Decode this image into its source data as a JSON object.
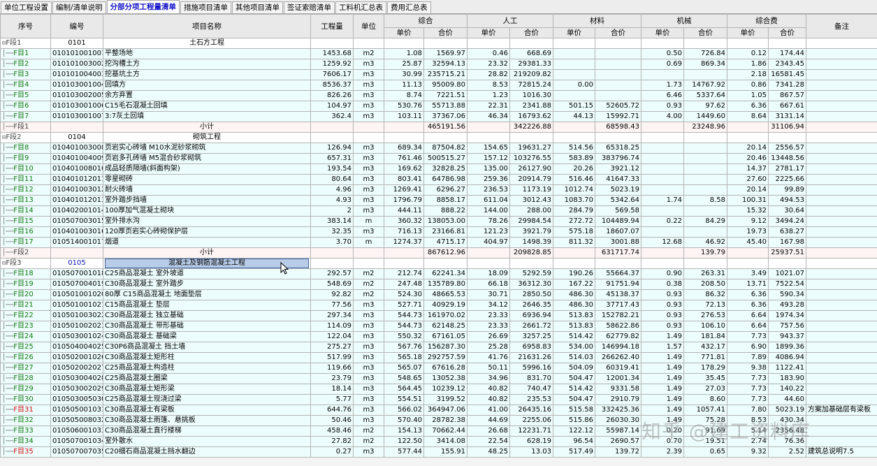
{
  "tabs": [
    "单位工程设置",
    "编制/清单说明",
    "分部分项工程量清单",
    "措施项目清单",
    "其他项目清单",
    "签证索赔清单",
    "工料机汇总表",
    "费用汇总表"
  ],
  "header": {
    "seq": "序号",
    "code": "编号",
    "name": "项目名称",
    "qty": "工程量",
    "unit": "单位",
    "groups": [
      "综合",
      "人工",
      "材料",
      "机械",
      "综合费"
    ],
    "unit_price": "单价",
    "total": "合价",
    "remark": "备注"
  },
  "rows": [
    {
      "type": "seg",
      "seq": "F段1",
      "code": "0101",
      "name": "土石方工程"
    },
    {
      "type": "item",
      "seq": "F目1",
      "code": "010101001001",
      "name": "平整场地",
      "qty": "1453.68",
      "unit": "m2",
      "c": [
        "1.08",
        "1569.97",
        "0.46",
        "668.69",
        "",
        "",
        "0.50",
        "726.84",
        "0.12",
        "174.44"
      ],
      "remark": ""
    },
    {
      "type": "item",
      "seq": "F目2",
      "code": "010101003002",
      "name": "挖沟槽土方",
      "qty": "1259.92",
      "unit": "m3",
      "c": [
        "25.87",
        "32594.13",
        "23.32",
        "29381.33",
        "",
        "",
        "0.69",
        "869.34",
        "1.86",
        "2343.45"
      ],
      "remark": ""
    },
    {
      "type": "item",
      "seq": "F目3",
      "code": "010101004003",
      "name": "挖基坑土方",
      "qty": "7606.17",
      "unit": "m3",
      "c": [
        "30.99",
        "235715.21",
        "28.82",
        "219209.82",
        "",
        "",
        "",
        "",
        "2.18",
        "16581.45"
      ],
      "remark": ""
    },
    {
      "type": "item",
      "seq": "F目4",
      "code": "010103001004",
      "name": "回填方",
      "qty": "8536.37",
      "unit": "m3",
      "c": [
        "11.13",
        "95009.80",
        "8.53",
        "72815.24",
        "0.00",
        "",
        "1.73",
        "14767.92",
        "0.86",
        "7341.28"
      ],
      "remark": ""
    },
    {
      "type": "item",
      "seq": "F目5",
      "code": "010103002005",
      "name": "余方弃置",
      "qty": "826.26",
      "unit": "m3",
      "c": [
        "8.74",
        "7221.51",
        "1.23",
        "1016.30",
        "",
        "",
        "6.46",
        "5337.64",
        "1.05",
        "867.57"
      ],
      "remark": ""
    },
    {
      "type": "item",
      "seq": "F目6",
      "code": "010103001006",
      "name": "C15毛石混凝土回填",
      "qty": "104.97",
      "unit": "m3",
      "c": [
        "530.76",
        "55713.88",
        "22.31",
        "2341.88",
        "501.15",
        "52605.72",
        "0.93",
        "97.62",
        "6.36",
        "667.61"
      ],
      "remark": ""
    },
    {
      "type": "item",
      "seq": "F目7",
      "code": "010103001007",
      "name": "3:7灰土回填",
      "qty": "362.4",
      "unit": "m3",
      "c": [
        "103.11",
        "37367.06",
        "46.34",
        "16793.62",
        "44.13",
        "15992.71",
        "4.00",
        "1449.60",
        "8.64",
        "3131.14"
      ],
      "remark": ""
    },
    {
      "type": "sub",
      "seq": "F段1",
      "name": "小计",
      "c": [
        "",
        "465191.56",
        "",
        "342226.88",
        "",
        "68598.43",
        "",
        "23248.96",
        "",
        "31106.94"
      ]
    },
    {
      "type": "seg",
      "seq": "F段2",
      "code": "0104",
      "name": "砌筑工程"
    },
    {
      "type": "item",
      "seq": "F目8",
      "code": "010401003008",
      "name": "页岩实心砖墙  M10水泥砂浆砌筑",
      "qty": "126.94",
      "unit": "m3",
      "c": [
        "689.34",
        "87504.82",
        "154.65",
        "19631.27",
        "514.56",
        "65318.25",
        "",
        "",
        "20.14",
        "2556.57"
      ],
      "remark": ""
    },
    {
      "type": "item",
      "seq": "F目9",
      "code": "010401004009",
      "name": "页岩多孔砖墙  M5混合砂浆砌筑",
      "qty": "657.31",
      "unit": "m3",
      "c": [
        "761.46",
        "500515.27",
        "157.12",
        "103276.55",
        "583.89",
        "383796.74",
        "",
        "",
        "20.46",
        "13448.56"
      ],
      "remark": ""
    },
    {
      "type": "item",
      "seq": "F目10",
      "code": "010401008010",
      "name": "成品轻质隔墙(斜面构架)",
      "qty": "193.54",
      "unit": "m3",
      "c": [
        "169.62",
        "32828.25",
        "135.00",
        "26127.90",
        "20.26",
        "3921.12",
        "",
        "",
        "14.37",
        "2781.17"
      ],
      "remark": ""
    },
    {
      "type": "item",
      "seq": "F目11",
      "code": "010401012011",
      "name": "零星砌砖",
      "qty": "80.64",
      "unit": "m3",
      "c": [
        "803.41",
        "64786.98",
        "259.36",
        "20914.79",
        "516.46",
        "41647.33",
        "",
        "",
        "27.60",
        "2225.66"
      ],
      "remark": ""
    },
    {
      "type": "item",
      "seq": "F目12",
      "code": "010401003012",
      "name": "耐火砖墙",
      "qty": "4.96",
      "unit": "m3",
      "c": [
        "1269.41",
        "6296.27",
        "236.53",
        "1173.19",
        "1012.74",
        "5023.19",
        "",
        "",
        "20.14",
        "99.89"
      ],
      "remark": ""
    },
    {
      "type": "item",
      "seq": "F目13",
      "code": "010401012013",
      "name": "室外踏步挡墙",
      "qty": "4.93",
      "unit": "m3",
      "c": [
        "1796.79",
        "8858.17",
        "611.04",
        "3012.43",
        "1083.70",
        "5342.64",
        "1.74",
        "8.58",
        "100.31",
        "494.53"
      ],
      "remark": ""
    },
    {
      "type": "item",
      "seq": "F目14",
      "code": "010402001014",
      "name": "100厚加气混凝土砌块",
      "qty": "2",
      "unit": "m3",
      "c": [
        "444.11",
        "888.22",
        "144.00",
        "288.00",
        "284.79",
        "569.58",
        "",
        "",
        "15.32",
        "30.64"
      ],
      "remark": ""
    },
    {
      "type": "item",
      "seq": "F目15",
      "code": "010507003015",
      "name": "室外排水沟",
      "qty": "383.14",
      "unit": "m",
      "c": [
        "360.32",
        "138053.00",
        "78.26",
        "29984.54",
        "272.72",
        "104489.94",
        "0.22",
        "84.29",
        "9.12",
        "3494.24"
      ],
      "remark": ""
    },
    {
      "type": "item",
      "seq": "F目16",
      "code": "010401003016",
      "name": "120厚页岩实心砖砌保护层",
      "qty": "32.35",
      "unit": "m3",
      "c": [
        "716.13",
        "23166.81",
        "121.23",
        "3921.79",
        "575.18",
        "18607.07",
        "",
        "",
        "19.73",
        "638.27"
      ],
      "remark": ""
    },
    {
      "type": "item",
      "seq": "F目17",
      "code": "010514001017",
      "name": "烟道",
      "qty": "3.70",
      "unit": "m",
      "c": [
        "1274.37",
        "4715.17",
        "404.97",
        "1498.39",
        "811.32",
        "3001.88",
        "12.68",
        "46.92",
        "45.40",
        "167.98"
      ],
      "remark": ""
    },
    {
      "type": "sub",
      "seq": "F段2",
      "name": "小计",
      "c": [
        "",
        "867612.96",
        "",
        "209828.85",
        "",
        "631717.74",
        "",
        "139.79",
        "",
        "25937.51"
      ]
    },
    {
      "type": "seg",
      "seq": "F段3",
      "code": "0105",
      "name": "混凝土及钢筋混凝土工程",
      "selected": true
    },
    {
      "type": "item",
      "seq": "F目18",
      "code": "010507001018",
      "name": "C25商品混凝土 室外坡道",
      "qty": "292.57",
      "unit": "m2",
      "c": [
        "212.74",
        "62241.34",
        "18.09",
        "5292.59",
        "190.26",
        "55664.37",
        "0.90",
        "263.31",
        "3.49",
        "1021.07"
      ],
      "remark": ""
    },
    {
      "type": "item",
      "seq": "F目19",
      "code": "010507004019",
      "name": "C30商品混凝土 室外踏步",
      "qty": "548.69",
      "unit": "m2",
      "c": [
        "247.48",
        "135789.80",
        "66.18",
        "36312.30",
        "167.22",
        "91751.94",
        "0.38",
        "208.50",
        "13.71",
        "7522.54"
      ],
      "remark": ""
    },
    {
      "type": "item",
      "seq": "F目20",
      "code": "010501001020",
      "name": "80厚 C15商品混凝土 地面垫层",
      "qty": "92.82",
      "unit": "m2",
      "c": [
        "524.30",
        "48665.53",
        "30.71",
        "2850.50",
        "486.30",
        "45138.37",
        "0.93",
        "86.32",
        "6.36",
        "590.34"
      ],
      "remark": ""
    },
    {
      "type": "item",
      "seq": "F目21",
      "code": "010501001021",
      "name": "C15商品混凝土 垫层",
      "qty": "77.56",
      "unit": "m3",
      "c": [
        "527.71",
        "40929.19",
        "34.12",
        "2646.35",
        "486.30",
        "37717.43",
        "0.93",
        "72.13",
        "6.36",
        "493.28"
      ],
      "remark": ""
    },
    {
      "type": "item",
      "seq": "F目22",
      "code": "010501003022",
      "name": "C30商品混凝土 独立基础",
      "qty": "297.34",
      "unit": "m3",
      "c": [
        "544.73",
        "161970.02",
        "23.33",
        "6936.94",
        "513.83",
        "152782.21",
        "0.93",
        "276.53",
        "6.64",
        "1974.34"
      ],
      "remark": ""
    },
    {
      "type": "item",
      "seq": "F目23",
      "code": "010501002023",
      "name": "C30商品混凝土 带形基础",
      "qty": "114.09",
      "unit": "m3",
      "c": [
        "544.73",
        "62148.25",
        "23.33",
        "2661.72",
        "513.83",
        "58622.86",
        "0.93",
        "106.10",
        "6.64",
        "757.56"
      ],
      "remark": ""
    },
    {
      "type": "item",
      "seq": "F目24",
      "code": "010503001024",
      "name": "C30商品混凝土 基础梁",
      "qty": "122.04",
      "unit": "m3",
      "c": [
        "550.32",
        "67161.05",
        "26.69",
        "3257.25",
        "514.42",
        "62779.82",
        "1.49",
        "181.84",
        "7.73",
        "943.37"
      ],
      "remark": ""
    },
    {
      "type": "item",
      "seq": "F目25",
      "code": "010504004025",
      "name": "C30P6商品混凝土 挡土墙",
      "qty": "275.27",
      "unit": "m3",
      "c": [
        "567.76",
        "156287.30",
        "25.28",
        "6958.83",
        "534.00",
        "146994.18",
        "1.57",
        "432.17",
        "6.90",
        "1899.36"
      ],
      "remark": ""
    },
    {
      "type": "item",
      "seq": "F目26",
      "code": "010502001026",
      "name": "C30商品混凝土矩形柱",
      "qty": "517.99",
      "unit": "m3",
      "c": [
        "565.18",
        "292757.59",
        "41.76",
        "21631.26",
        "514.03",
        "266262.40",
        "1.49",
        "771.81",
        "7.89",
        "4086.94"
      ],
      "remark": ""
    },
    {
      "type": "item",
      "seq": "F目27",
      "code": "010502002027",
      "name": "C25商品混凝土构造柱",
      "qty": "119.66",
      "unit": "m3",
      "c": [
        "565.07",
        "67616.28",
        "50.11",
        "5996.16",
        "504.09",
        "60319.41",
        "1.49",
        "178.29",
        "9.38",
        "1122.41"
      ],
      "remark": ""
    },
    {
      "type": "item",
      "seq": "F目28",
      "code": "010503004028",
      "name": "C25商品混凝土圈梁",
      "qty": "23.79",
      "unit": "m3",
      "c": [
        "548.65",
        "13052.38",
        "34.96",
        "831.70",
        "504.47",
        "12001.34",
        "1.49",
        "35.45",
        "7.73",
        "183.90"
      ],
      "remark": ""
    },
    {
      "type": "item",
      "seq": "F目29",
      "code": "010503002029",
      "name": "C30商品混凝土矩形梁",
      "qty": "18.14",
      "unit": "m3",
      "c": [
        "564.45",
        "10239.12",
        "40.82",
        "740.47",
        "514.42",
        "9331.58",
        "1.49",
        "27.03",
        "7.73",
        "140.22"
      ],
      "remark": ""
    },
    {
      "type": "item",
      "seq": "F目30",
      "code": "010503005030",
      "name": "C25商品混凝土现浇过梁",
      "qty": "5.77",
      "unit": "m3",
      "c": [
        "554.51",
        "3199.52",
        "40.82",
        "235.53",
        "504.47",
        "2910.79",
        "1.49",
        "8.60",
        "7.73",
        "44.60"
      ],
      "remark": ""
    },
    {
      "type": "item",
      "seq": "F目31",
      "code": "010505001031",
      "name": "C30商品混凝土有梁板",
      "qty": "644.76",
      "unit": "m3",
      "c": [
        "566.02",
        "364947.06",
        "41.00",
        "26435.16",
        "515.58",
        "332425.36",
        "1.49",
        "1057.41",
        "7.80",
        "5023.19"
      ],
      "remark": "方案加基础层有梁板",
      "red": true
    },
    {
      "type": "item",
      "seq": "F目32",
      "code": "010505008032",
      "name": "C30商品混凝土雨篷、悬挑板",
      "qty": "50.46",
      "unit": "m3",
      "c": [
        "570.40",
        "28782.38",
        "44.69",
        "2255.06",
        "515.86",
        "26030.30",
        "1.49",
        "75.28",
        "8.53",
        "430.34"
      ],
      "remark": ""
    },
    {
      "type": "item",
      "seq": "F目33",
      "code": "010506001033",
      "name": "C30商品混凝土直行楼梯",
      "qty": "458.46",
      "unit": "m2",
      "c": [
        "154.13",
        "70662.44",
        "26.68",
        "12231.71",
        "122.12",
        "55987.14",
        "0.20",
        "91.69",
        "5.14",
        "2356.48"
      ],
      "remark": ""
    },
    {
      "type": "item",
      "seq": "F目34",
      "code": "010507001034",
      "name": "室外散水",
      "qty": "27.82",
      "unit": "m2",
      "c": [
        "122.50",
        "3414.08",
        "22.54",
        "628.19",
        "96.54",
        "2690.57",
        "0.70",
        "19.51",
        "2.74",
        "76.36"
      ],
      "remark": ""
    },
    {
      "type": "item",
      "seq": "F目35",
      "code": "010507007035",
      "name": "C20细石商品混凝土挡水翻边",
      "qty": "0.27",
      "unit": "m3",
      "c": [
        "577.44",
        "155.91",
        "48.25",
        "13.03",
        "517.49",
        "139.72",
        "2.39",
        "0.65",
        "9.32",
        "2.52"
      ],
      "remark": "建筑总说明7.5",
      "red": true
    }
  ],
  "watermark": "知乎 @建工资料库"
}
